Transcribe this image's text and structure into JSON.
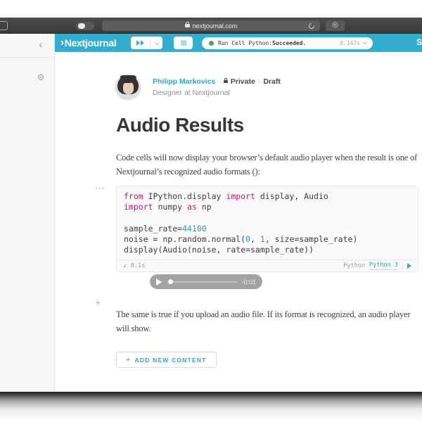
{
  "browser": {
    "url": "nextjournal.com",
    "extensions_glyph": "◎"
  },
  "app_header": {
    "logo_mark": "›",
    "logo_text": "Nextjournal",
    "status_pill": {
      "label": "Run Cell Python: ",
      "state": "Succeeded.",
      "elapsed": "0.147s"
    },
    "share_fragment": "S"
  },
  "sidebar": {
    "collapse_glyph": "‹",
    "gear_glyph": "⚙"
  },
  "article": {
    "author": {
      "name": "Philipp Markovics",
      "separator": "·",
      "visibility": "Private",
      "draft_label": "Draft",
      "role": "Designer at Nextjournal"
    },
    "title": "Audio Results",
    "intro": "Code cells will now display your browser’s default audio player when the result is one of Nextjournal’s recognized audio formats ():",
    "body2": "The same is true if you upload an audio file. If its format is recognized, an audio player will show.",
    "cell_menu_glyph": "···",
    "insert_plus_glyph": "+",
    "add_button_plus": "+",
    "add_button_label": "ADD NEW CONTENT"
  },
  "code_cell": {
    "lines": [
      [
        [
          "k",
          "from"
        ],
        [
          "p",
          " IPython.display "
        ],
        [
          "k",
          "import"
        ],
        [
          "p",
          " display, Audio"
        ]
      ],
      [
        [
          "k",
          "import"
        ],
        [
          "p",
          " numpy "
        ],
        [
          "k",
          "as"
        ],
        [
          "p",
          " np"
        ]
      ],
      [],
      [
        [
          "p",
          "sample_rate="
        ],
        [
          "n",
          "44100"
        ]
      ],
      [
        [
          "p",
          "noise = np.random.normal("
        ],
        [
          "n",
          "0"
        ],
        [
          "p",
          ", "
        ],
        [
          "n",
          "1"
        ],
        [
          "p",
          ", size=sample_rate)"
        ]
      ],
      [
        [
          "p",
          "display(Audio(noise, rate=sample_rate))"
        ]
      ]
    ],
    "check_glyph": "✓",
    "elapsed": "0.1s",
    "language_label": "Python",
    "runtime_link": "Python 3"
  },
  "audio_player": {
    "remaining": "-0:01"
  },
  "colors": {
    "accent_teal": "#35adce",
    "keyword_pink": "#c2186b",
    "number_blue": "#3e8fb0",
    "success_green": "#3fae53"
  }
}
